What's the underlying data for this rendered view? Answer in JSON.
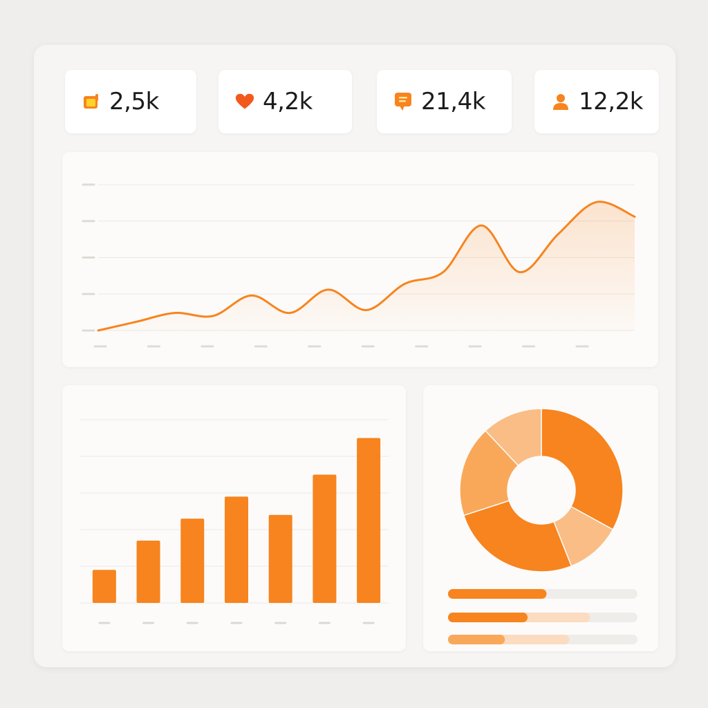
{
  "colors": {
    "accent": "#f7841e",
    "accent_light": "#f9a85a",
    "accent_pale": "#f9bd85",
    "track": "#efeeec",
    "grid": "#ebe8e4"
  },
  "stats": [
    {
      "icon": "square-badge-icon",
      "value": "2,5k"
    },
    {
      "icon": "heart-icon",
      "value": "4,2k"
    },
    {
      "icon": "comment-icon",
      "value": "21,4k"
    },
    {
      "icon": "user-icon",
      "value": "12,2k"
    }
  ],
  "chart_data": [
    {
      "type": "area",
      "title": "",
      "x": [
        0,
        1,
        2,
        3,
        4,
        5,
        6,
        7,
        8,
        9,
        10,
        11,
        12,
        13,
        14
      ],
      "values": [
        0.0,
        0.3,
        0.6,
        0.5,
        1.2,
        0.6,
        1.4,
        0.7,
        1.6,
        2.0,
        3.6,
        2.0,
        3.3,
        4.4,
        3.9
      ],
      "ylim": [
        0,
        5
      ],
      "grid": true,
      "legend": "none"
    },
    {
      "type": "bar",
      "title": "",
      "values": [
        18,
        34,
        46,
        58,
        48,
        70,
        90
      ],
      "ylim": [
        0,
        100
      ],
      "grid": true,
      "legend": "none"
    },
    {
      "type": "pie",
      "title": "",
      "values": [
        33,
        11,
        26,
        18,
        12
      ],
      "donut": true,
      "legend": "none"
    },
    {
      "type": "progress",
      "bars": [
        {
          "value": 0.52,
          "secondary": 0.52
        },
        {
          "value": 0.42,
          "secondary": 0.75
        },
        {
          "value": 0.3,
          "secondary": 0.64
        }
      ]
    }
  ]
}
